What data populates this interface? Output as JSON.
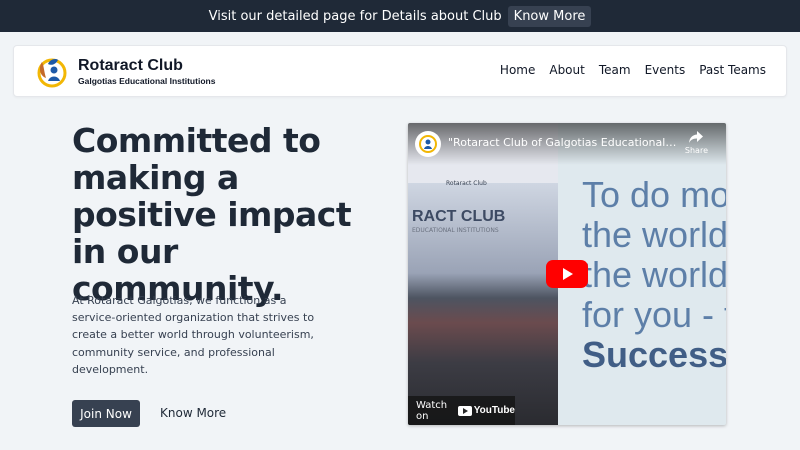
{
  "announcement": {
    "text": "Visit our detailed page for Details about Club",
    "button_label": "Know More"
  },
  "brand": {
    "title": "Rotaract Club",
    "subtitle": "Galgotias Educational Institutions",
    "logo_icon": "rotaract-logo-icon"
  },
  "nav": {
    "links": [
      {
        "label": "Home"
      },
      {
        "label": "About"
      },
      {
        "label": "Team"
      },
      {
        "label": "Events"
      },
      {
        "label": "Past Teams"
      }
    ]
  },
  "hero": {
    "headline": "Committed to making a positive impact in our community.",
    "description": "At Rotaract Galgotias, we function as a service-oriented organization that strives to create a better world through volunteerism, community service, and professional development.",
    "primary_button": "Join Now",
    "secondary_button": "Know More"
  },
  "video": {
    "title": "\"Rotaract Club of Galgotias Educational Instit...",
    "share_label": "Share",
    "watch_on_label": "Watch on",
    "youtube_label": "YouTube",
    "thumbnail_banner": "RACT CLUB",
    "thumbnail_sub": "EDUCATIONAL INSTITUTIONS",
    "thumbnail_logo_text": "Rotaract Club",
    "slide_lines": [
      "To do mo",
      "the world",
      "the world",
      "for you - t",
      "Success."
    ]
  },
  "colors": {
    "primary_dark": "#1f2937",
    "button_dark": "#374151",
    "page_bg": "#f1f4f7",
    "youtube_red": "#ff0000"
  }
}
